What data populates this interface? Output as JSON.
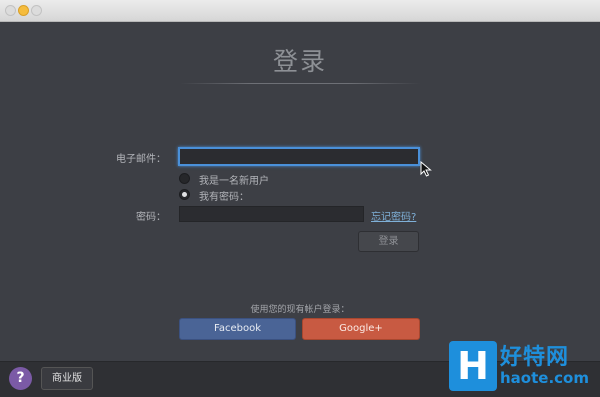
{
  "titlebar": {
    "buttons": [
      "close",
      "minimize",
      "maximize"
    ]
  },
  "login": {
    "title": "登录",
    "email_label": "电子邮件：",
    "email_value": "",
    "radio_new_user": "我是一名新用户",
    "radio_have_password": "我有密码：",
    "selected_option": "have_password",
    "password_label": "密码：",
    "password_value": "",
    "forgot_password": "忘记密码?",
    "login_button": "登录"
  },
  "social": {
    "label": "使用您的现有帐户登录：",
    "facebook": "Facebook",
    "google": "Google+"
  },
  "footer": {
    "help": "?",
    "edition": "商业版"
  },
  "watermark": {
    "logo_letter": "H",
    "name": "好特网",
    "url": "haote.com"
  },
  "colors": {
    "background": "#3d3f45",
    "focus_accent": "#4a90d9",
    "facebook": "#4a6496",
    "google": "#c85a42",
    "help": "#7b5aa6"
  },
  "icons": {
    "cursor": "arrow-cursor-icon",
    "help": "question-mark-icon"
  }
}
